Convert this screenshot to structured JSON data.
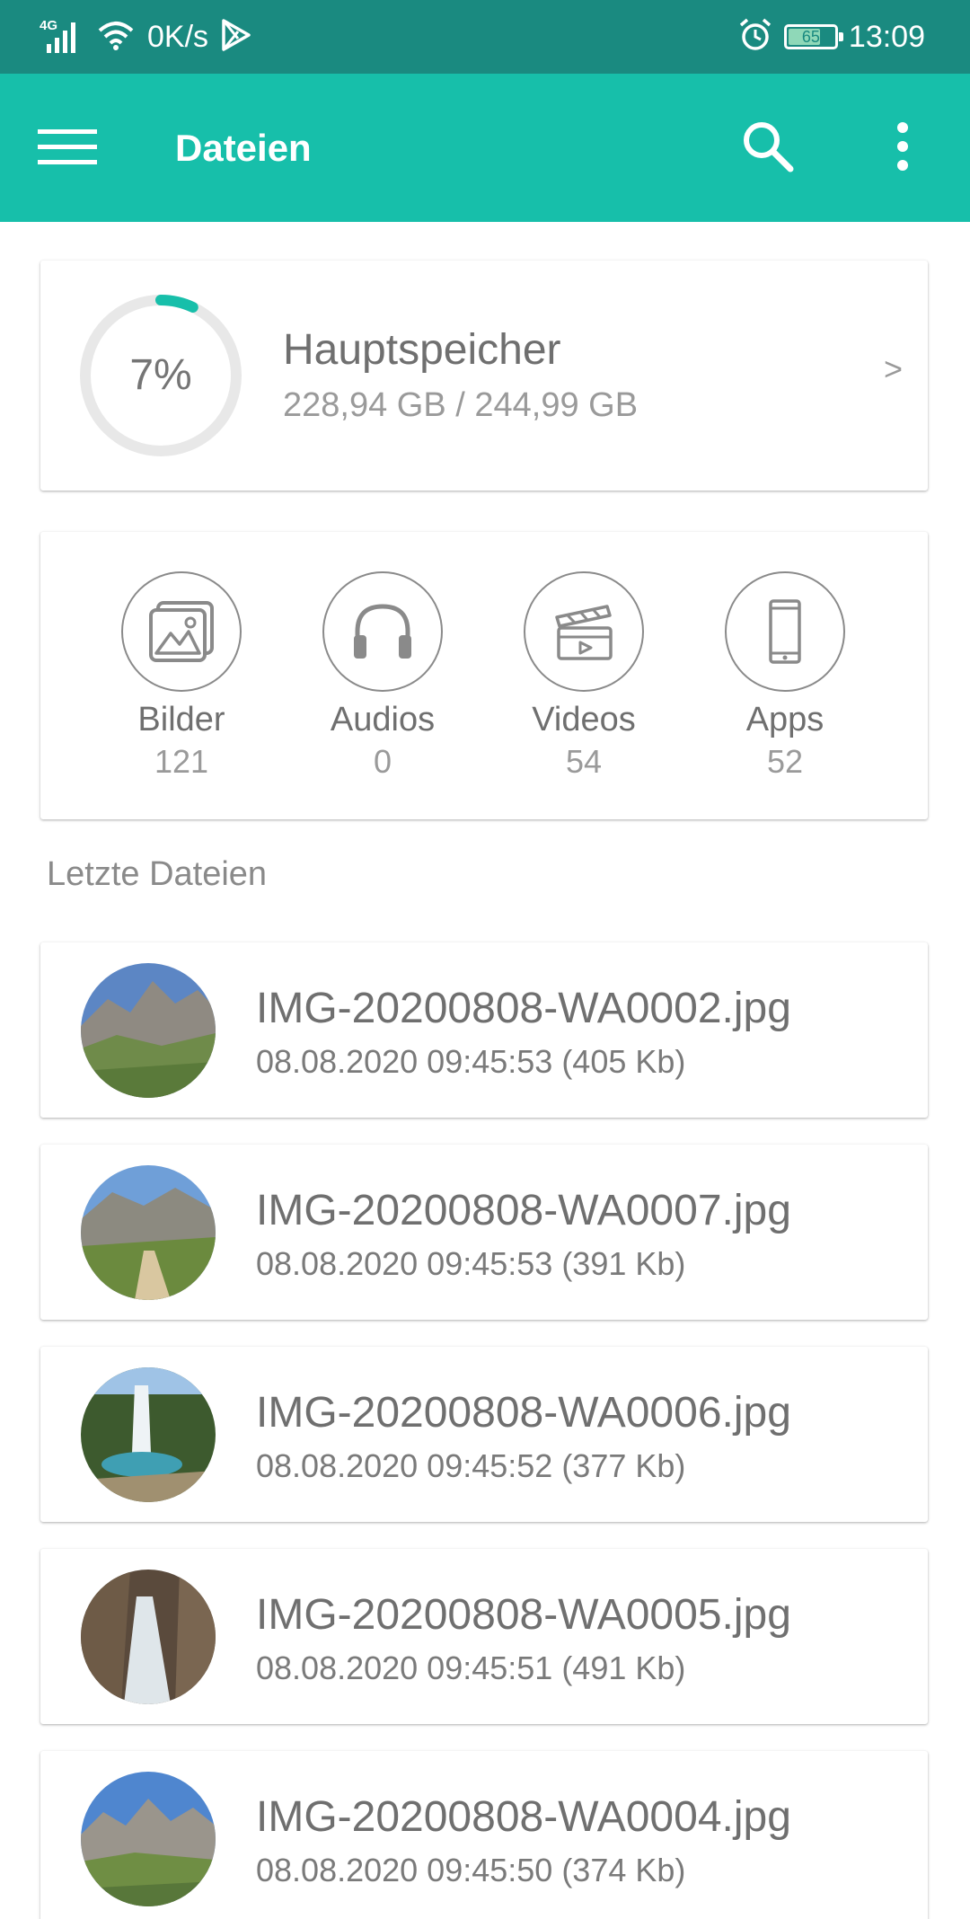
{
  "status_bar": {
    "network": "4G",
    "speed": "0K/s",
    "battery_level": "65",
    "battery_fraction": 0.65,
    "time": "13:09",
    "icons": [
      "signal-icon",
      "wifi-icon",
      "play-store-icon",
      "alarm-icon",
      "battery-icon"
    ]
  },
  "app_bar": {
    "title": "Dateien",
    "icons": [
      "menu-icon",
      "search-icon",
      "more-vert-icon"
    ]
  },
  "storage": {
    "percent_label": "7%",
    "percent_value": 0.07,
    "name": "Hauptspeicher",
    "size": "228,94 GB / 244,99 GB",
    "chevron": ">",
    "accent_color": "#17bfaa"
  },
  "categories": [
    {
      "label": "Bilder",
      "count": "121",
      "icon": "image-icon"
    },
    {
      "label": "Audios",
      "count": "0",
      "icon": "headphones-icon"
    },
    {
      "label": "Videos",
      "count": "54",
      "icon": "clapperboard-icon"
    },
    {
      "label": "Apps",
      "count": "52",
      "icon": "phone-icon"
    }
  ],
  "recent": {
    "title": "Letzte Dateien",
    "files": [
      {
        "name": "IMG-20200808-WA0002.jpg",
        "meta": "08.08.2020 09:45:53 (405 Kb)"
      },
      {
        "name": "IMG-20200808-WA0007.jpg",
        "meta": "08.08.2020 09:45:53 (391 Kb)"
      },
      {
        "name": "IMG-20200808-WA0006.jpg",
        "meta": "08.08.2020 09:45:52 (377 Kb)"
      },
      {
        "name": "IMG-20200808-WA0005.jpg",
        "meta": "08.08.2020 09:45:51 (491 Kb)"
      },
      {
        "name": "IMG-20200808-WA0004.jpg",
        "meta": "08.08.2020 09:45:50 (374 Kb)"
      }
    ]
  },
  "colors": {
    "status_bar": "#1a8a80",
    "app_bar": "#17bfaa",
    "text_primary": "#6f6f6f",
    "text_secondary": "#9a9a9a"
  }
}
